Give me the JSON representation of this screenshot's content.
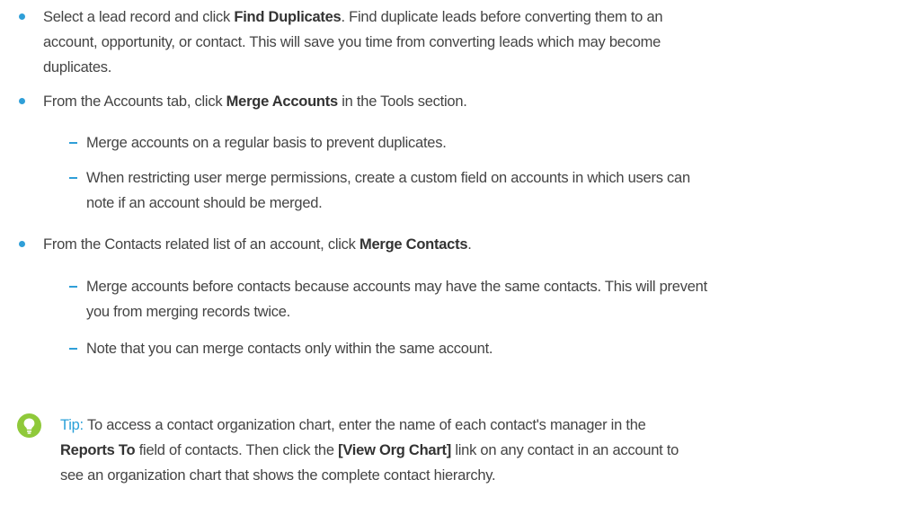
{
  "bullets": [
    {
      "line1_pre": "Select a lead record and click ",
      "line1_bold": "Find Duplicates",
      "line1_post": ". Find duplicate leads before converting them to an",
      "line2": "account, opportunity, or contact. This will save you time from converting leads which may become",
      "line3": "duplicates."
    },
    {
      "line1_pre": "From the Accounts tab, click ",
      "line1_bold": "Merge Accounts",
      "line1_post": " in the Tools section.",
      "subitems": [
        {
          "line1": "Merge accounts on a regular basis to prevent duplicates."
        },
        {
          "line1": "When restricting user merge permissions, create a custom field on accounts in which users can",
          "line2": "note if an account should be merged."
        }
      ]
    },
    {
      "line1_pre": "From the Contacts related list of an account, click ",
      "line1_bold": "Merge Contacts",
      "line1_post": ".",
      "subitems": [
        {
          "line1": "Merge accounts before contacts because accounts may have the same contacts. This will prevent",
          "line2": "you from merging records twice."
        },
        {
          "line1": "Note that you can merge contacts only within the same account."
        }
      ]
    }
  ],
  "tip": {
    "icon": "lightbulb-icon",
    "label": "Tip:",
    "line1": " To access a contact organization chart, enter the name of each contact's manager in the",
    "line2_bold1": "Reports To",
    "line2_mid": " field of contacts. Then click the ",
    "line2_bold2": "[View Org Chart]",
    "line2_post": " link on any contact in an account to",
    "line3": "see an organization chart that shows the complete contact hierarchy."
  },
  "colors": {
    "accent": "#2f9fd8",
    "icon_green": "#8fc93a",
    "text": "#444444"
  }
}
